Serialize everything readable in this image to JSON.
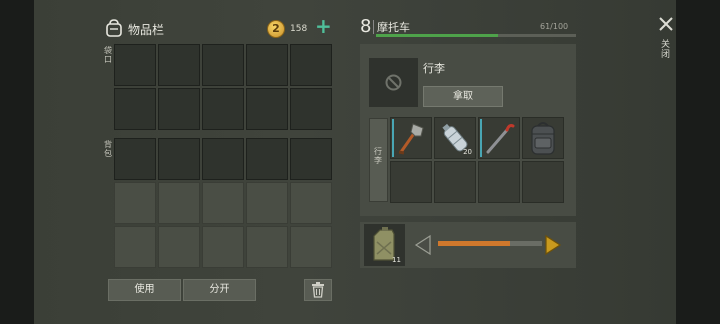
{
  "inventory": {
    "title": "物品栏",
    "coin_count": "158",
    "coin_symbol": "2",
    "add_symbol": "+",
    "pocket_label": "袋口",
    "bag_label": "背包",
    "use_label": "使用",
    "split_label": "分开",
    "icons": {
      "title": "backpack-icon",
      "coin": "coin-icon",
      "add": "plus-icon",
      "trash": "trash-icon"
    }
  },
  "vehicle": {
    "level": "8",
    "name": "摩托车",
    "capacity": "61/100",
    "durability_fraction": 0.61,
    "durability_color": "#4ea24a",
    "trunk_name": "行李",
    "take_label": "拿取",
    "side_tab_label": "行李",
    "items": [
      {
        "name": "shovel",
        "icon": "shovel-icon",
        "qty": ""
      },
      {
        "name": "water-bottle",
        "icon": "water-bottle-icon",
        "qty": "20"
      },
      {
        "name": "crowbar",
        "icon": "crowbar-icon",
        "qty": ""
      },
      {
        "name": "backpack",
        "icon": "backpack-item-icon",
        "qty": ""
      }
    ]
  },
  "fuel": {
    "icon": "jerrycan-icon",
    "qty": "11",
    "slider_fraction": 0.69,
    "slider_color": "#d0782c"
  },
  "close": {
    "label": "关闭",
    "icon": "close-icon"
  }
}
